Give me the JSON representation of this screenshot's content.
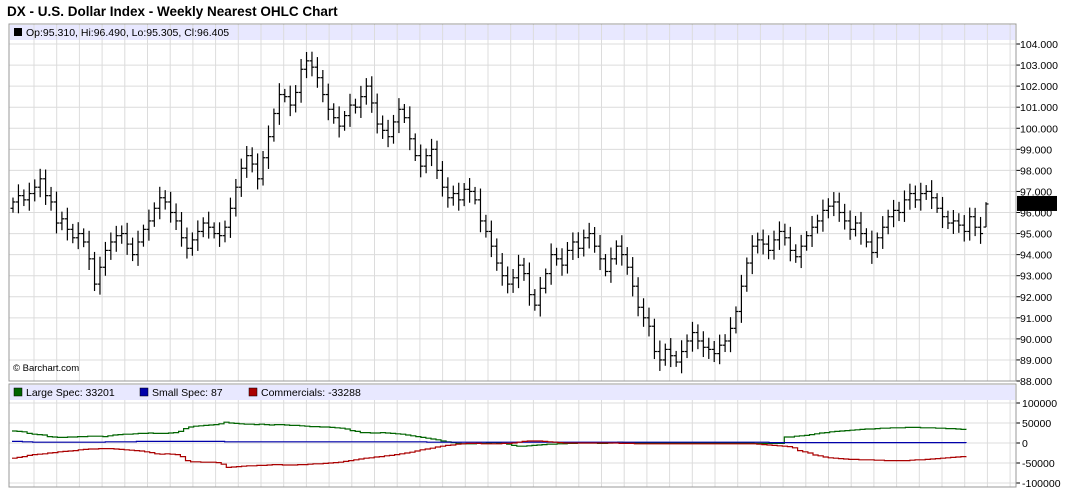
{
  "title": "DX - U.S. Dollar Index - Weekly Nearest OHLC Chart",
  "credit": "© Barchart.com",
  "colors": {
    "grid": "#dcdcdc",
    "band": "#e8e8ff",
    "price": "#000000",
    "large_spec": "#006400",
    "small_spec": "#0000aa",
    "commercials": "#aa0000",
    "last_price_box": "#000000"
  },
  "chart_data": [
    {
      "type": "ohlc",
      "title": "DX - U.S. Dollar Index - Weekly Nearest OHLC Chart",
      "info_line": "Op:95.310, Hi:96.490, Lo:95.305, Cl:96.405",
      "last_price_label": "96.405",
      "ylim": [
        88.0,
        104.0
      ],
      "y_tick_labels": [
        "104.000",
        "103.000",
        "102.000",
        "101.000",
        "100.000",
        "99.000",
        "98.000",
        "97.000",
        "96.000",
        "95.000",
        "94.000",
        "93.000",
        "92.000",
        "91.000",
        "90.000",
        "89.000",
        "88.000"
      ],
      "grid": true,
      "closes": [
        96.5,
        96.8,
        96.6,
        96.9,
        97.2,
        97.6,
        96.8,
        96.5,
        95.5,
        95.7,
        95.2,
        94.8,
        95.0,
        94.6,
        93.8,
        92.6,
        93.4,
        94.2,
        94.6,
        94.9,
        95.0,
        94.5,
        94.0,
        94.6,
        95.2,
        95.6,
        96.2,
        96.7,
        96.5,
        96.0,
        95.6,
        94.8,
        94.3,
        94.7,
        95.1,
        95.5,
        95.3,
        95.0,
        94.9,
        95.3,
        96.2,
        97.2,
        98.1,
        98.7,
        98.3,
        97.6,
        98.6,
        99.6,
        100.7,
        101.6,
        101.5,
        101.1,
        101.7,
        102.8,
        103.2,
        102.9,
        102.4,
        101.6,
        100.9,
        100.5,
        100.1,
        100.6,
        101.1,
        101.0,
        101.5,
        102.0,
        101.2,
        100.2,
        99.9,
        99.6,
        100.3,
        100.9,
        100.5,
        99.5,
        98.7,
        98.2,
        98.7,
        99.0,
        98.0,
        97.2,
        96.7,
        96.9,
        96.6,
        97.1,
        97.0,
        96.6,
        95.6,
        95.1,
        94.4,
        93.6,
        93.0,
        92.6,
        92.9,
        93.5,
        93.1,
        92.1,
        91.6,
        92.4,
        93.1,
        94.0,
        93.8,
        93.5,
        94.2,
        94.6,
        94.3,
        94.8,
        95.0,
        94.4,
        93.8,
        93.2,
        93.8,
        94.4,
        94.0,
        93.4,
        92.5,
        91.5,
        91.0,
        90.6,
        89.4,
        89.0,
        89.5,
        89.2,
        88.9,
        89.4,
        89.9,
        90.3,
        89.9,
        89.6,
        89.5,
        89.3,
        89.7,
        89.9,
        90.5,
        91.3,
        92.5,
        93.6,
        94.4,
        94.7,
        94.5,
        94.2,
        94.7,
        95.1,
        94.8,
        94.2,
        93.9,
        94.4,
        94.9,
        95.3,
        95.6,
        96.1,
        96.3,
        96.5,
        96.0,
        95.6,
        95.2,
        95.5,
        95.0,
        94.6,
        94.1,
        94.8,
        95.3,
        95.8,
        96.1,
        96.0,
        96.6,
        96.9,
        96.6,
        96.9,
        97.0,
        96.7,
        96.2,
        95.8,
        95.5,
        95.6,
        95.4,
        95.1,
        95.8,
        95.3,
        95.0,
        96.405
      ],
      "last_bar": {
        "open": 95.31,
        "high": 96.49,
        "low": 95.305,
        "close": 96.405
      }
    },
    {
      "type": "line",
      "ylim": [
        -100000,
        100000
      ],
      "y_tick_labels": [
        "100000",
        "50000",
        "0",
        "-50000",
        "-100000"
      ],
      "series": [
        {
          "name": "Large Spec",
          "legend": "Large Spec: 33201",
          "color": "#006400",
          "values": [
            30000,
            29000,
            28000,
            24000,
            22000,
            21000,
            20000,
            16000,
            15000,
            14000,
            14000,
            15000,
            15000,
            16000,
            16000,
            17000,
            17000,
            17000,
            16000,
            18000,
            20000,
            21000,
            22000,
            22000,
            23000,
            24000,
            24000,
            25000,
            24000,
            24000,
            24000,
            25000,
            26000,
            29000,
            36000,
            40000,
            42000,
            43000,
            44000,
            45000,
            46000,
            48000,
            52000,
            50000,
            49000,
            48000,
            47000,
            47000,
            46000,
            47000,
            46000,
            45000,
            46000,
            46000,
            45000,
            44000,
            44000,
            43000,
            42000,
            41000,
            41000,
            40000,
            40000,
            39000,
            38000,
            37000,
            35000,
            31000,
            29000,
            26000,
            26000,
            25000,
            25000,
            26000,
            25000,
            24000,
            23000,
            22000,
            20000,
            18000,
            16000,
            14000,
            12000,
            10000,
            8000,
            5000,
            3000,
            1000,
            -1000,
            -2000,
            -2000,
            -2000,
            -1000,
            -1000,
            0,
            1000,
            0,
            -1000,
            -3000,
            -6000,
            -8000,
            -8000,
            -7000,
            -6000,
            -5000,
            -4000,
            -3000,
            -3000,
            -2000,
            -2000,
            -1000,
            -1000,
            0,
            0,
            0,
            0,
            -1000,
            -1000,
            0,
            1000,
            2000,
            1000,
            0,
            0,
            0,
            0,
            0,
            0,
            0,
            0,
            0,
            0,
            0,
            0,
            0,
            0,
            0,
            0,
            0,
            0,
            0,
            0,
            0,
            0,
            0,
            0,
            0,
            -1000,
            -1000,
            -1000,
            -1000,
            -1000,
            -1000,
            15000,
            15000,
            17000,
            18000,
            19000,
            21000,
            23000,
            25000,
            26000,
            28000,
            29000,
            30000,
            31000,
            32000,
            33000,
            34000,
            35000,
            35000,
            36000,
            37000,
            37000,
            38000,
            38000,
            38000,
            39000,
            39000,
            39000,
            38000,
            38000,
            38000,
            37000,
            37000,
            36000,
            36000,
            35000,
            34000,
            33201
          ]
        },
        {
          "name": "Small Spec",
          "legend": "Small Spec: 87",
          "color": "#0000aa",
          "values": [
            4000,
            4000,
            3000,
            3000,
            2000,
            2000,
            2000,
            2000,
            2000,
            2000,
            2000,
            2000,
            2000,
            2000,
            2000,
            2000,
            2000,
            2000,
            3000,
            3000,
            3000,
            3000,
            3000,
            3000,
            4000,
            4000,
            4000,
            4000,
            4000,
            4000,
            4000,
            4000,
            4000,
            4000,
            4000,
            4000,
            4000,
            4000,
            4000,
            4000,
            4000,
            3000,
            3000,
            3000,
            3000,
            3000,
            3000,
            3000,
            3000,
            3000,
            3000,
            3000,
            3000,
            3000,
            3000,
            3000,
            3000,
            3000,
            3000,
            3000,
            3000,
            3000,
            3000,
            3000,
            3000,
            3000,
            3000,
            3000,
            3000,
            3000,
            3000,
            3000,
            3000,
            3000,
            3000,
            3000,
            3000,
            3000,
            3000,
            3000,
            2000,
            2000,
            2000,
            2000,
            2000,
            2000,
            2000,
            2000,
            2000,
            2000,
            2000,
            2000,
            2000,
            2000,
            2000,
            2000,
            2000,
            2000,
            2000,
            2000,
            2000,
            2000,
            2000,
            2000,
            2000,
            2000,
            2000,
            2000,
            2000,
            2000,
            2000,
            2000,
            2000,
            2000,
            2000,
            2000,
            2000,
            2000,
            2000,
            2000,
            2000,
            2000,
            2000,
            2000,
            2000,
            2000,
            2000,
            2000,
            2000,
            2000,
            2000,
            2000,
            2000,
            2000,
            2000,
            2000,
            2000,
            2000,
            2000,
            2000,
            2000,
            2000,
            2000,
            2000,
            2000,
            2000,
            1000,
            1000,
            1000,
            1000,
            1000,
            1000,
            1000,
            1000,
            1000,
            1000,
            1000,
            1000,
            1000,
            1000,
            1000,
            1000,
            1000,
            1000,
            1000,
            1000,
            1000,
            1000,
            1000,
            1000,
            1000,
            1000,
            1000,
            1000,
            1000,
            1000,
            1000,
            1000,
            1000,
            1000,
            1000,
            1000,
            1000,
            1000,
            87
          ]
        },
        {
          "name": "Commercials",
          "legend": "Commercials: -33288",
          "color": "#aa0000",
          "values": [
            -38000,
            -36000,
            -34000,
            -31000,
            -29000,
            -28000,
            -27000,
            -25000,
            -24000,
            -22000,
            -21000,
            -20000,
            -19000,
            -17000,
            -16000,
            -15000,
            -15000,
            -14000,
            -14000,
            -14000,
            -15000,
            -16000,
            -17000,
            -18000,
            -19000,
            -20000,
            -22000,
            -24000,
            -27000,
            -28000,
            -27000,
            -28000,
            -29000,
            -34000,
            -44000,
            -47000,
            -47000,
            -48000,
            -48000,
            -48000,
            -49000,
            -53000,
            -61000,
            -60000,
            -59000,
            -58000,
            -57000,
            -57000,
            -56000,
            -56000,
            -55000,
            -54000,
            -54000,
            -55000,
            -55000,
            -55000,
            -54000,
            -54000,
            -53000,
            -52000,
            -52000,
            -51000,
            -50000,
            -49000,
            -48000,
            -46000,
            -44000,
            -42000,
            -40000,
            -38000,
            -37000,
            -35000,
            -34000,
            -32000,
            -31000,
            -29000,
            -27000,
            -25000,
            -23000,
            -20000,
            -17000,
            -15000,
            -13000,
            -10000,
            -8000,
            -6000,
            -5000,
            -3000,
            -2000,
            -1000,
            -1000,
            -1000,
            -2000,
            -2000,
            -2000,
            -2000,
            -1000,
            -1000,
            0,
            2000,
            4000,
            5000,
            5000,
            5000,
            4000,
            3000,
            2000,
            1000,
            0,
            0,
            0,
            0,
            0,
            0,
            0,
            0,
            0,
            0,
            0,
            -1000,
            -1000,
            -1000,
            -2000,
            -2000,
            -2000,
            -2000,
            -2000,
            -2000,
            -2000,
            -2000,
            -2000,
            -2000,
            -2000,
            -2000,
            -2000,
            -2000,
            -2000,
            -2000,
            -2000,
            -2000,
            -2000,
            -2000,
            -2000,
            -2000,
            -2000,
            -2000,
            -3000,
            -4000,
            -5000,
            -6000,
            -7000,
            -8000,
            -9000,
            -12000,
            -19000,
            -22000,
            -25000,
            -30000,
            -32000,
            -35000,
            -37000,
            -38000,
            -39000,
            -40000,
            -41000,
            -41000,
            -42000,
            -42000,
            -42000,
            -43000,
            -43000,
            -44000,
            -44000,
            -44000,
            -44000,
            -44000,
            -43000,
            -42000,
            -42000,
            -41000,
            -40000,
            -39000,
            -38000,
            -37000,
            -36000,
            -35000,
            -34000,
            -33288
          ]
        }
      ]
    }
  ]
}
